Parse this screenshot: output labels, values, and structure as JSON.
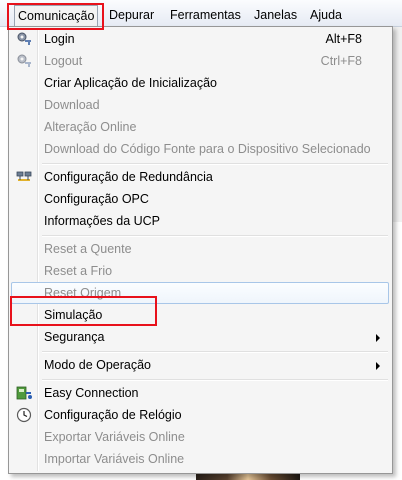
{
  "menubar": {
    "items": [
      "Comunicação",
      "Depurar",
      "Ferramentas",
      "Janelas",
      "Ajuda"
    ]
  },
  "menu": {
    "items": [
      {
        "label": "Login",
        "shortcut": "Alt+F8",
        "enabled": true,
        "icon": "gear-key-icon"
      },
      {
        "label": "Logout",
        "shortcut": "Ctrl+F8",
        "enabled": false,
        "icon": "gear-key-icon"
      },
      {
        "label": "Criar Aplicação de Inicialização",
        "enabled": true
      },
      {
        "label": "Download",
        "enabled": false
      },
      {
        "label": "Alteração Online",
        "enabled": false
      },
      {
        "label": "Download do Código Fonte para o Dispositivo Selecionado",
        "enabled": false
      },
      {
        "label": "Configuração de Redundância",
        "enabled": true,
        "icon": "redundancy-icon"
      },
      {
        "label": "Configuração OPC",
        "enabled": true
      },
      {
        "label": "Informações da UCP",
        "enabled": true
      },
      {
        "label": "Reset a Quente",
        "enabled": false
      },
      {
        "label": "Reset a Frio",
        "enabled": false
      },
      {
        "label": "Reset Origem",
        "enabled": false,
        "hovered": true
      },
      {
        "label": "Simulação",
        "enabled": true,
        "annotated": true
      },
      {
        "label": "Segurança",
        "enabled": true,
        "submenu": true
      },
      {
        "label": "Modo de Operação",
        "enabled": true,
        "submenu": true
      },
      {
        "label": "Easy Connection",
        "enabled": true,
        "icon": "easy-connection-icon"
      },
      {
        "label": "Configuração de Relógio",
        "enabled": true,
        "icon": "clock-icon"
      },
      {
        "label": "Exportar Variáveis Online",
        "enabled": false
      },
      {
        "label": "Importar Variáveis Online",
        "enabled": false
      }
    ]
  },
  "colors": {
    "annotation_red": "#e8111b",
    "disabled_text": "#8d8d8d",
    "hover_border": "#a8c6e8"
  }
}
